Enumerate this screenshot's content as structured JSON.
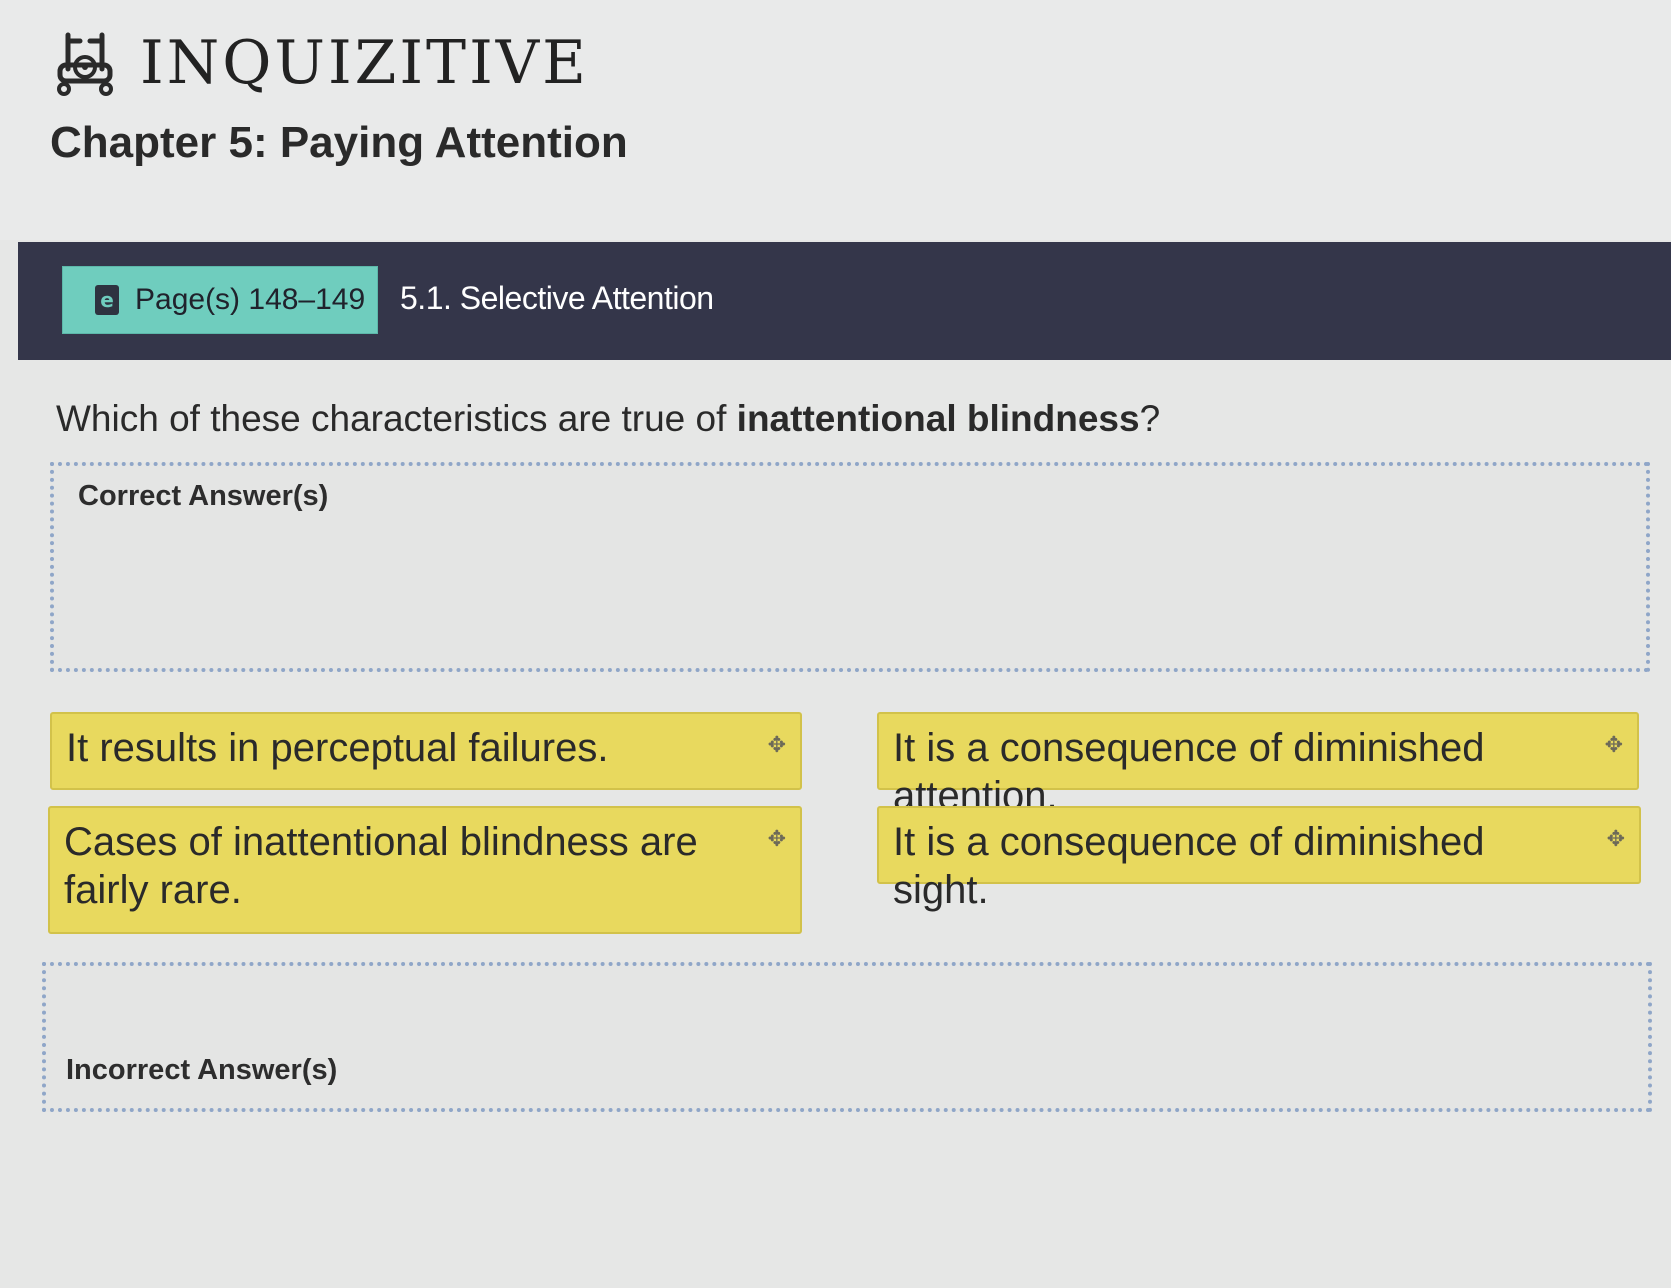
{
  "header": {
    "brand_name": "INQUIZITIVE",
    "chapter_title": "Chapter 5: Paying Attention"
  },
  "topic_bar": {
    "page_ref_label": "Page(s) 148–149",
    "ebook_icon_glyph": "e",
    "section_title": "5.1. Selective Attention"
  },
  "question": {
    "text_before": "Which of these characteristics are true of ",
    "emphasis": "inattentional blindness",
    "text_after": "?"
  },
  "dropzones": {
    "correct_label": "Correct Answer(s)",
    "incorrect_label": "Incorrect Answer(s)"
  },
  "cards": [
    {
      "text": "It results in perceptual failures."
    },
    {
      "text": "It is a consequence of diminished attention."
    },
    {
      "text": "Cases of inattentional blindness are fairly rare."
    },
    {
      "text": "It is a consequence of diminished sight."
    }
  ],
  "icons": {
    "move": "move-icon",
    "brand": "inquizitive-logo-icon",
    "ebook": "ebook-icon"
  },
  "colors": {
    "topic_bar": "#34364a",
    "page_ref": "#6fcdbe",
    "card": "#e8d95e",
    "dropzone_border": "#8fa6c8"
  }
}
